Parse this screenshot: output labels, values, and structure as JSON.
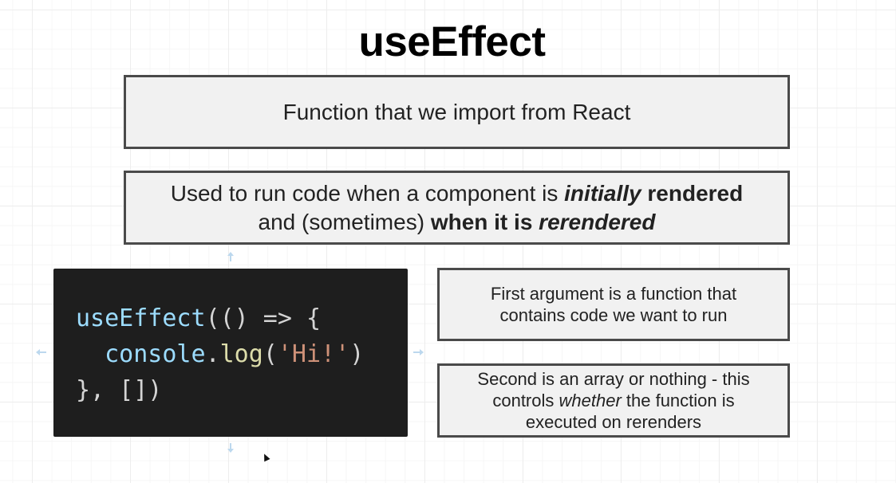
{
  "title": "useEffect",
  "box1": {
    "text": "Function that we import from React"
  },
  "box2": {
    "line1_part1": "Used to run code when a component is ",
    "line1_em": "initially",
    "line1_bold": " rendered",
    "line2_part1": "and (sometimes) ",
    "line2_bold": "when it is ",
    "line2_em": "rerendered"
  },
  "code": {
    "line1_fn": "useEffect",
    "line1_rest": "(() => {",
    "line2_indent": "  ",
    "line2_obj": "console",
    "line2_dot": ".",
    "line2_method": "log",
    "line2_open": "(",
    "line2_str": "'Hi!'",
    "line2_close": ")",
    "line3": "}, [])"
  },
  "box3": {
    "line1": "First argument is a function that",
    "line2": "contains code we want to run"
  },
  "box4": {
    "line1": "Second is an array or nothing - this",
    "line2_em": "whether",
    "line2_pre": "controls ",
    "line2_post": " the function is",
    "line3": "executed on rerenders"
  },
  "icons": {
    "up": "arrow-up-icon",
    "down": "arrow-down-icon",
    "left": "arrow-left-icon",
    "right": "arrow-right-icon",
    "cursor": "mouse-cursor-icon"
  },
  "colors": {
    "code_bg": "#1e1e1e",
    "box_bg": "#f1f1f1",
    "box_border": "#4a4a4a"
  }
}
